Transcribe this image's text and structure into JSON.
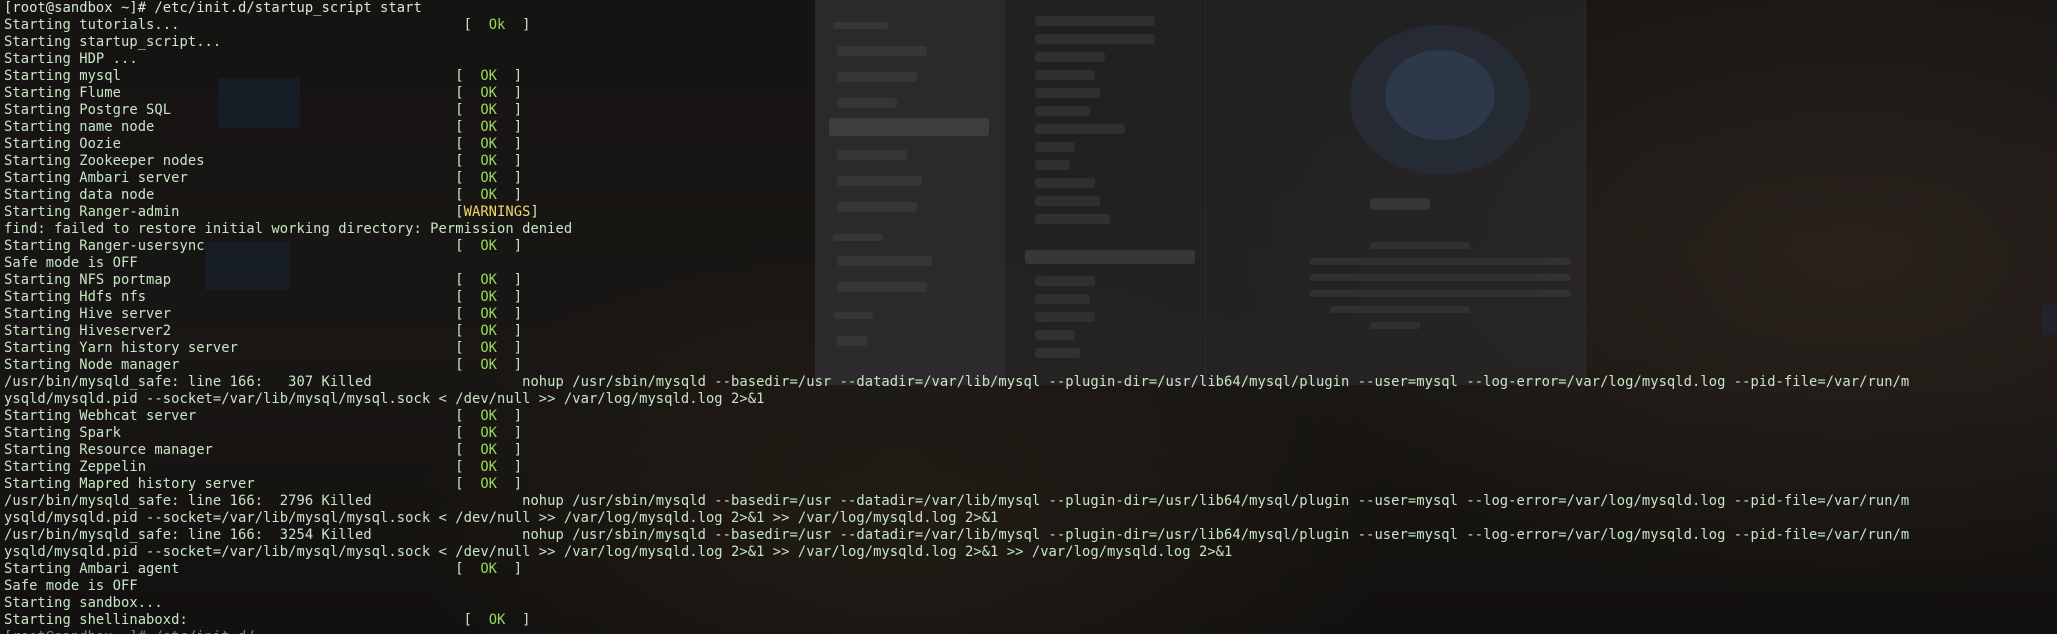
{
  "colors": {
    "terminal_text": "#c8e6c4",
    "ok_status": "#99d957",
    "warning_status": "#f5d76e",
    "background": "#1b1816"
  },
  "terminal": {
    "lines": [
      {
        "text": "[root@sandbox ~]# /etc/init.d/startup_script start",
        "kind": "prompt"
      },
      {
        "pre": "Starting tutorials...                                  [  ",
        "status": "Ok",
        "post": "  ]"
      },
      {
        "text": "Starting startup_script..."
      },
      {
        "text": "Starting HDP ..."
      },
      {
        "pre": "Starting mysql                                        [  ",
        "status": "OK",
        "post": "  ]"
      },
      {
        "pre": "Starting Flume                                        [  ",
        "status": "OK",
        "post": "  ]"
      },
      {
        "pre": "Starting Postgre SQL                                  [  ",
        "status": "OK",
        "post": "  ]"
      },
      {
        "pre": "Starting name node                                    [  ",
        "status": "OK",
        "post": "  ]"
      },
      {
        "pre": "Starting Oozie                                        [  ",
        "status": "OK",
        "post": "  ]"
      },
      {
        "pre": "Starting Zookeeper nodes                              [  ",
        "status": "OK",
        "post": "  ]"
      },
      {
        "pre": "Starting Ambari server                                [  ",
        "status": "OK",
        "post": "  ]"
      },
      {
        "pre": "Starting data node                                    [  ",
        "status": "OK",
        "post": "  ]"
      },
      {
        "pre": "Starting Ranger-admin                                 [",
        "status": "WARNINGS",
        "post": "]",
        "warn": true
      },
      {
        "text": "find: failed to restore initial working directory: Permission denied"
      },
      {
        "pre": "Starting Ranger-usersync                              [  ",
        "status": "OK",
        "post": "  ]"
      },
      {
        "text": "Safe mode is OFF"
      },
      {
        "pre": "Starting NFS portmap                                  [  ",
        "status": "OK",
        "post": "  ]"
      },
      {
        "pre": "Starting Hdfs nfs                                     [  ",
        "status": "OK",
        "post": "  ]"
      },
      {
        "pre": "Starting Hive server                                  [  ",
        "status": "OK",
        "post": "  ]"
      },
      {
        "pre": "Starting Hiveserver2                                  [  ",
        "status": "OK",
        "post": "  ]"
      },
      {
        "pre": "Starting Yarn history server                          [  ",
        "status": "OK",
        "post": "  ]"
      },
      {
        "pre": "Starting Node manager                                 [  ",
        "status": "OK",
        "post": "  ]"
      },
      {
        "text": "/usr/bin/mysqld_safe: line 166:   307 Killed                  nohup /usr/sbin/mysqld --basedir=/usr --datadir=/var/lib/mysql --plugin-dir=/usr/lib64/mysql/plugin --user=mysql --log-error=/var/log/mysqld.log --pid-file=/var/run/m"
      },
      {
        "text": "ysqld/mysqld.pid --socket=/var/lib/mysql/mysql.sock < /dev/null >> /var/log/mysqld.log 2>&1"
      },
      {
        "pre": "Starting Webhcat server                               [  ",
        "status": "OK",
        "post": "  ]"
      },
      {
        "pre": "Starting Spark                                        [  ",
        "status": "OK",
        "post": "  ]"
      },
      {
        "pre": "Starting Resource manager                             [  ",
        "status": "OK",
        "post": "  ]"
      },
      {
        "pre": "Starting Zeppelin                                     [  ",
        "status": "OK",
        "post": "  ]"
      },
      {
        "pre": "Starting Mapred history server                        [  ",
        "status": "OK",
        "post": "  ]"
      },
      {
        "text": "/usr/bin/mysqld_safe: line 166:  2796 Killed                  nohup /usr/sbin/mysqld --basedir=/usr --datadir=/var/lib/mysql --plugin-dir=/usr/lib64/mysql/plugin --user=mysql --log-error=/var/log/mysqld.log --pid-file=/var/run/m"
      },
      {
        "text": "ysqld/mysqld.pid --socket=/var/lib/mysql/mysql.sock < /dev/null >> /var/log/mysqld.log 2>&1 >> /var/log/mysqld.log 2>&1"
      },
      {
        "text": "/usr/bin/mysqld_safe: line 166:  3254 Killed                  nohup /usr/sbin/mysqld --basedir=/usr --datadir=/var/lib/mysql --plugin-dir=/usr/lib64/mysql/plugin --user=mysql --log-error=/var/log/mysqld.log --pid-file=/var/run/m"
      },
      {
        "text": "ysqld/mysqld.pid --socket=/var/lib/mysql/mysql.sock < /dev/null >> /var/log/mysqld.log 2>&1 >> /var/log/mysqld.log 2>&1 >> /var/log/mysqld.log 2>&1"
      },
      {
        "pre": "Starting Ambari agent                                 [  ",
        "status": "OK",
        "post": "  ]"
      },
      {
        "text": "Safe mode is OFF"
      },
      {
        "text": "Starting sandbox..."
      },
      {
        "pre": "Starting shellinaboxd:                                 [  ",
        "status": "OK",
        "post": "  ]"
      },
      {
        "text": "[root@sandbox ~]# /etc/init.d/",
        "kind": "prompt",
        "cutoff": true
      }
    ]
  }
}
